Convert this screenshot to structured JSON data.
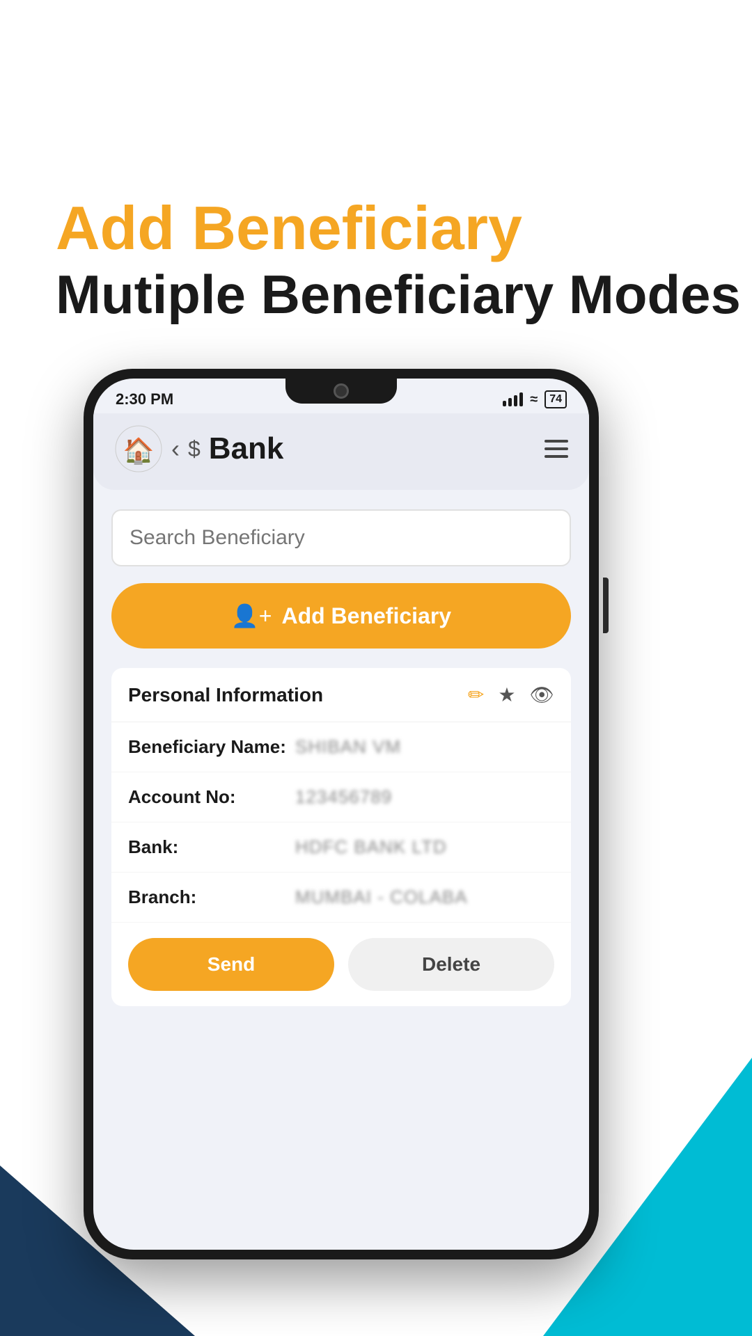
{
  "page": {
    "background_color": "#ffffff"
  },
  "header": {
    "line1": "Add Beneficiary",
    "line2": "Mutiple Beneficiary Modes"
  },
  "status_bar": {
    "time": "2:30 PM",
    "battery": "74"
  },
  "app_header": {
    "title": "Bank",
    "back_label": "‹",
    "dollar_label": "$",
    "menu_label": "☰"
  },
  "search": {
    "placeholder": "Search Beneficiary"
  },
  "add_button": {
    "label": "Add Beneficiary",
    "icon": "person-add"
  },
  "personal_info": {
    "section_title": "Personal Information",
    "fields": [
      {
        "label": "Beneficiary Name:",
        "value": "SHIBAN VM",
        "redacted": true
      },
      {
        "label": "Account No:",
        "value": "123456789",
        "redacted": true
      },
      {
        "label": "Bank:",
        "value": "HDFC BANK LTD",
        "redacted": true
      },
      {
        "label": "Branch:",
        "value": "MUMBAI - COLABA",
        "redacted": true
      }
    ],
    "send_label": "Send",
    "delete_label": "Delete"
  },
  "icons": {
    "edit": "✏️",
    "star": "★",
    "eye": "👁",
    "person_add": "👤+"
  },
  "colors": {
    "orange": "#F5A623",
    "dark": "#1a3a5c",
    "teal": "#00BCD4"
  }
}
